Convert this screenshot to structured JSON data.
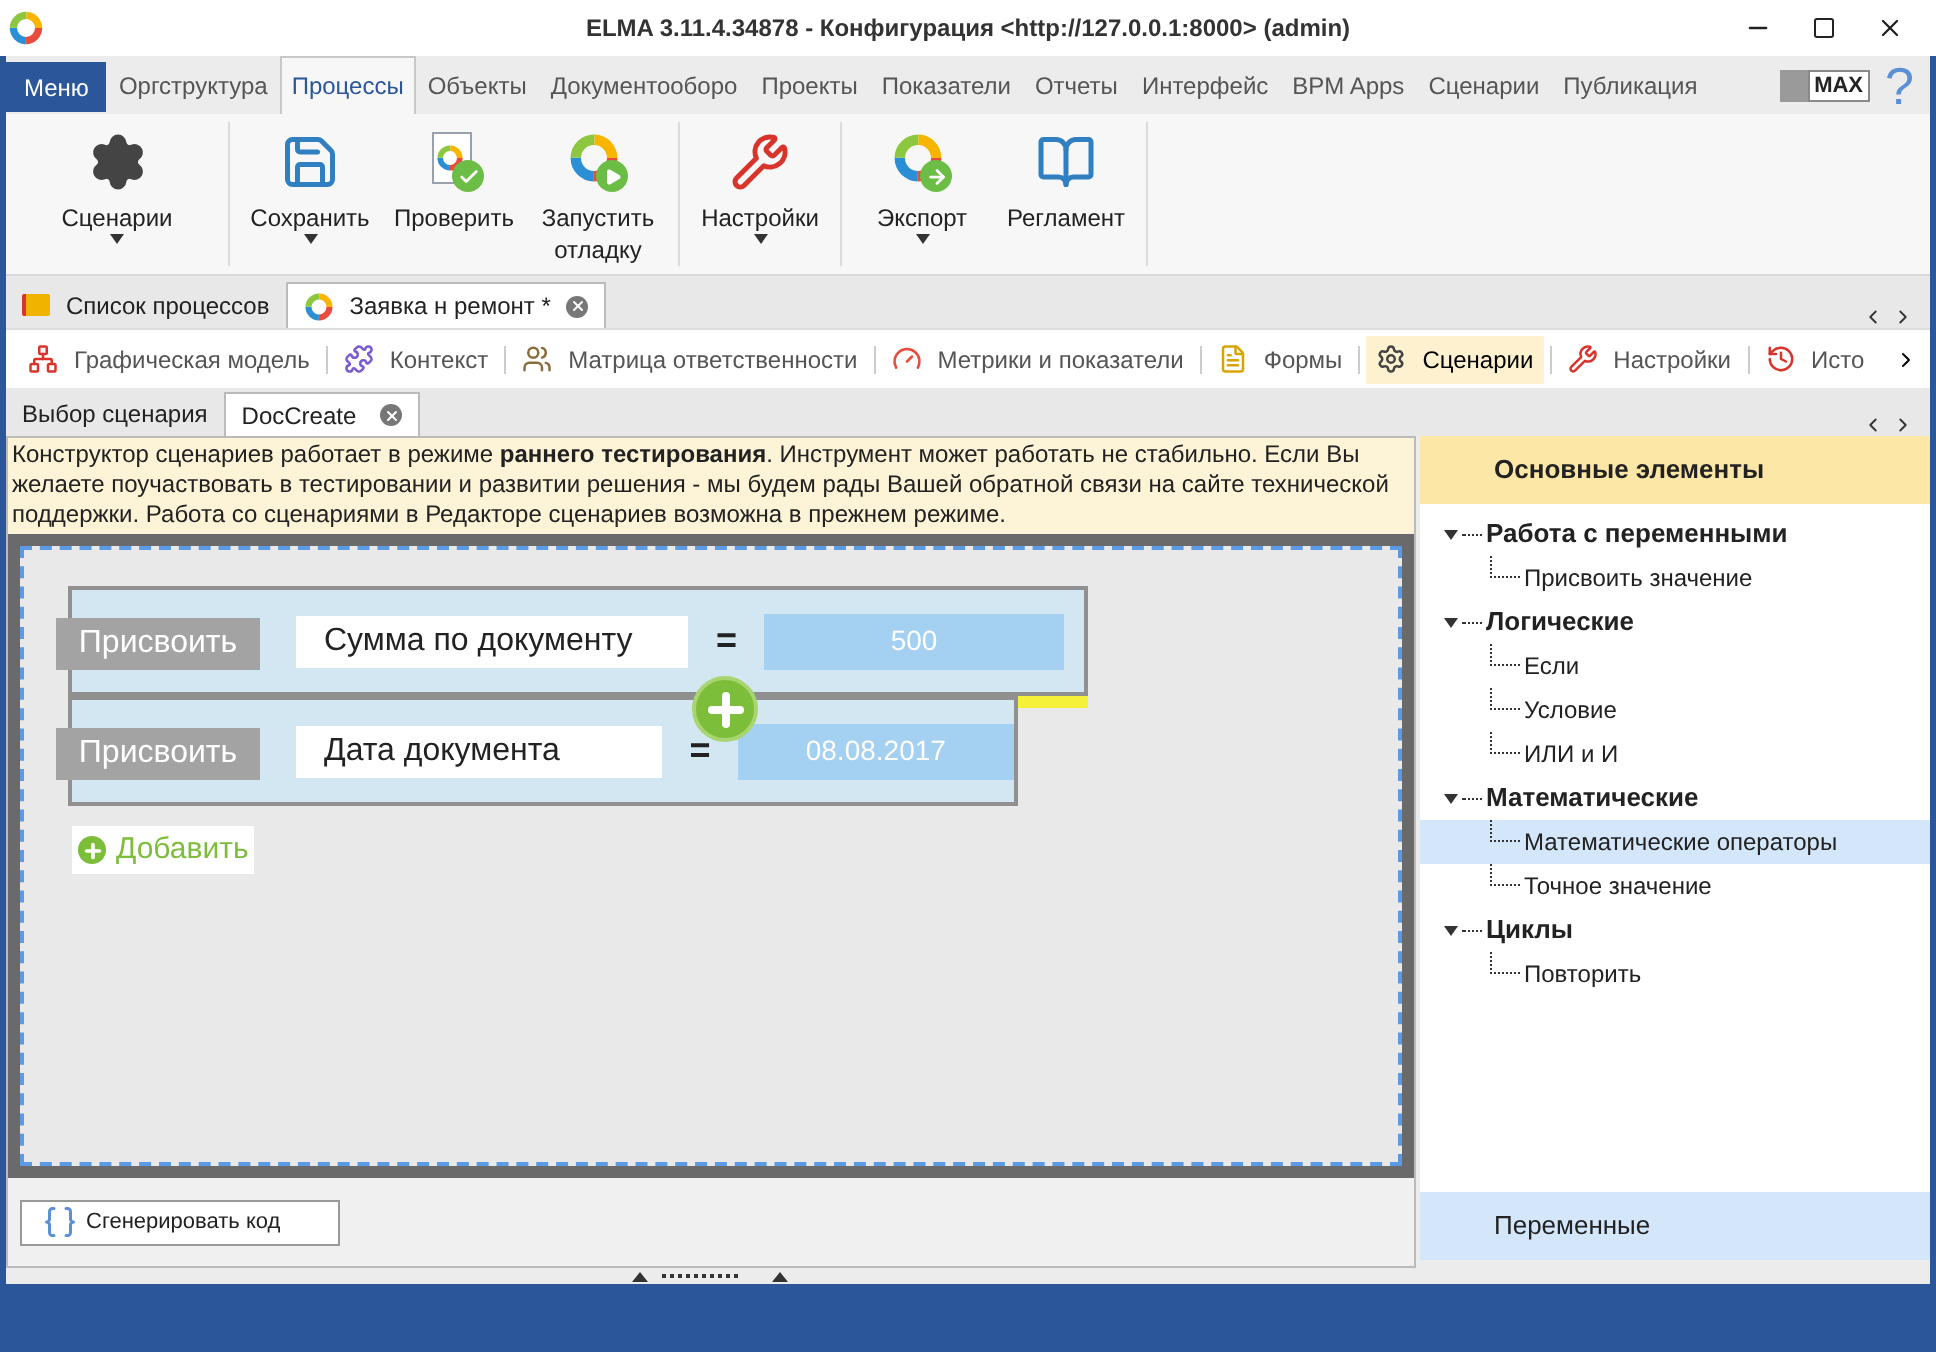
{
  "window": {
    "title": "ELMA 3.11.4.34878 - Конфигурация <http://127.0.0.1:8000> (admin)"
  },
  "menu_tabs": [
    {
      "label": "Меню",
      "kind": "menu"
    },
    {
      "label": "Оргструктура",
      "kind": "tab",
      "selected": false
    },
    {
      "label": "Процессы",
      "kind": "tab",
      "selected": true
    },
    {
      "label": "Объекты",
      "kind": "tab",
      "selected": false
    },
    {
      "label": "Документооборо",
      "kind": "tab",
      "selected": false
    },
    {
      "label": "Проекты",
      "kind": "tab",
      "selected": false
    },
    {
      "label": "Показатели",
      "kind": "tab",
      "selected": false
    },
    {
      "label": "Отчеты",
      "kind": "tab",
      "selected": false
    },
    {
      "label": "Интерфейс",
      "kind": "tab",
      "selected": false
    },
    {
      "label": "BPM Apps",
      "kind": "tab",
      "selected": false
    },
    {
      "label": "Сценарии",
      "kind": "tab",
      "selected": false
    },
    {
      "label": "Публикация",
      "kind": "tab",
      "selected": false
    }
  ],
  "max_badge": "MAX",
  "help": "?",
  "ribbon_groups": [
    [
      {
        "label": "Сценарии",
        "dropdown": true
      }
    ],
    [
      {
        "label": "Сохранить",
        "dropdown": true
      },
      {
        "label": "Проверить",
        "dropdown": false
      },
      {
        "label": "Запустить отладку",
        "dropdown": false
      }
    ],
    [
      {
        "label": "Настройки",
        "dropdown": true
      }
    ],
    [
      {
        "label": "Экспорт",
        "dropdown": true
      },
      {
        "label": "Регламент",
        "dropdown": false
      }
    ]
  ],
  "doc_tabs": [
    {
      "label": "Список процессов",
      "selected": false,
      "closable": false
    },
    {
      "label": "Заявка н ремонт *",
      "selected": true,
      "closable": true
    }
  ],
  "view_tabs": [
    {
      "label": "Графическая модель",
      "selected": false
    },
    {
      "label": "Контекст",
      "selected": false
    },
    {
      "label": "Матрица ответственности",
      "selected": false
    },
    {
      "label": "Метрики и показатели",
      "selected": false
    },
    {
      "label": "Формы",
      "selected": false
    },
    {
      "label": "Сценарии",
      "selected": true
    },
    {
      "label": "Настройки",
      "selected": false
    },
    {
      "label": "Исто",
      "selected": false
    }
  ],
  "scenario_tabs": [
    {
      "label": "Выбор сценария",
      "selected": false,
      "closable": false
    },
    {
      "label": "DocCreate",
      "selected": true,
      "closable": true
    }
  ],
  "notice": "Конструктор сценариев работает в режиме **раннего тестирования**. Инструмент может работать не стабильно. Если Вы желаете поучаствовать в тестировании и развитии решения - мы будем рады Вашей обратной связи на сайте технической поддержки. Работа со сценариями в Редакторе сценариев возможна в прежнем режиме.",
  "blocks": [
    {
      "action": "Присвоить",
      "variable": "Сумма по документу",
      "operator": "=",
      "value": "500",
      "highlighted": true
    },
    {
      "action": "Присвоить",
      "variable": "Дата документа",
      "operator": "=",
      "value": "08.08.2017",
      "highlighted": false
    }
  ],
  "add_button": "Добавить",
  "generate_button": "Сгенерировать код",
  "palette": {
    "header": "Основные элементы",
    "groups": [
      {
        "label": "Работа с переменными",
        "expanded": true,
        "children": [
          {
            "label": "Присвоить значение",
            "selected": false
          }
        ]
      },
      {
        "label": "Логические",
        "expanded": true,
        "children": [
          {
            "label": "Если",
            "selected": false
          },
          {
            "label": "Условие",
            "selected": false
          },
          {
            "label": "ИЛИ и И",
            "selected": false
          }
        ]
      },
      {
        "label": "Математические",
        "expanded": true,
        "children": [
          {
            "label": "Математические операторы",
            "selected": true
          },
          {
            "label": "Точное значение",
            "selected": false
          }
        ]
      },
      {
        "label": "Циклы",
        "expanded": true,
        "children": [
          {
            "label": "Повторить",
            "selected": false
          }
        ]
      }
    ],
    "footer": "Переменные"
  }
}
